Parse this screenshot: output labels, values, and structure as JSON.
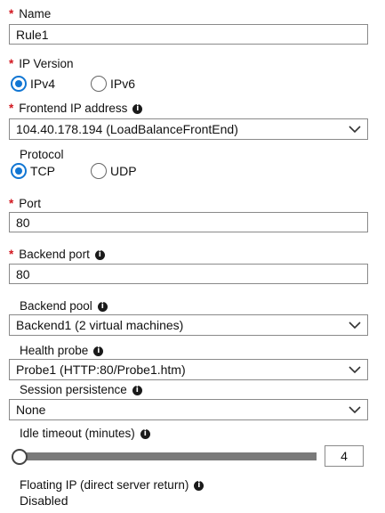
{
  "form": {
    "name": {
      "label": "Name",
      "required": true,
      "value": "Rule1"
    },
    "ip_version": {
      "label": "IP Version",
      "required": true,
      "options": [
        "IPv4",
        "IPv6"
      ],
      "selected": "IPv4"
    },
    "frontend_ip": {
      "label": "Frontend IP address",
      "required": true,
      "value": "104.40.178.194 (LoadBalanceFrontEnd)"
    },
    "protocol": {
      "label": "Protocol",
      "options": [
        "TCP",
        "UDP"
      ],
      "selected": "TCP"
    },
    "port": {
      "label": "Port",
      "required": true,
      "value": "80"
    },
    "backend_port": {
      "label": "Backend port",
      "required": true,
      "value": "80"
    },
    "backend_pool": {
      "label": "Backend pool",
      "value": "Backend1 (2 virtual machines)"
    },
    "health_probe": {
      "label": "Health probe",
      "value": "Probe1 (HTTP:80/Probe1.htm)"
    },
    "session_persistence": {
      "label": "Session persistence",
      "value": "None"
    },
    "idle_timeout": {
      "label": "Idle timeout (minutes)",
      "value": "4",
      "slider_fraction": 0.0
    },
    "floating_ip": {
      "label": "Floating IP (direct server return)",
      "value": "Disabled"
    }
  },
  "colors": {
    "required_marker": "#d2171f",
    "radio_accent": "#1176d3"
  },
  "icons": {
    "required": "asterisk",
    "info": "info-icon",
    "dropdown": "chevron-down-icon"
  }
}
